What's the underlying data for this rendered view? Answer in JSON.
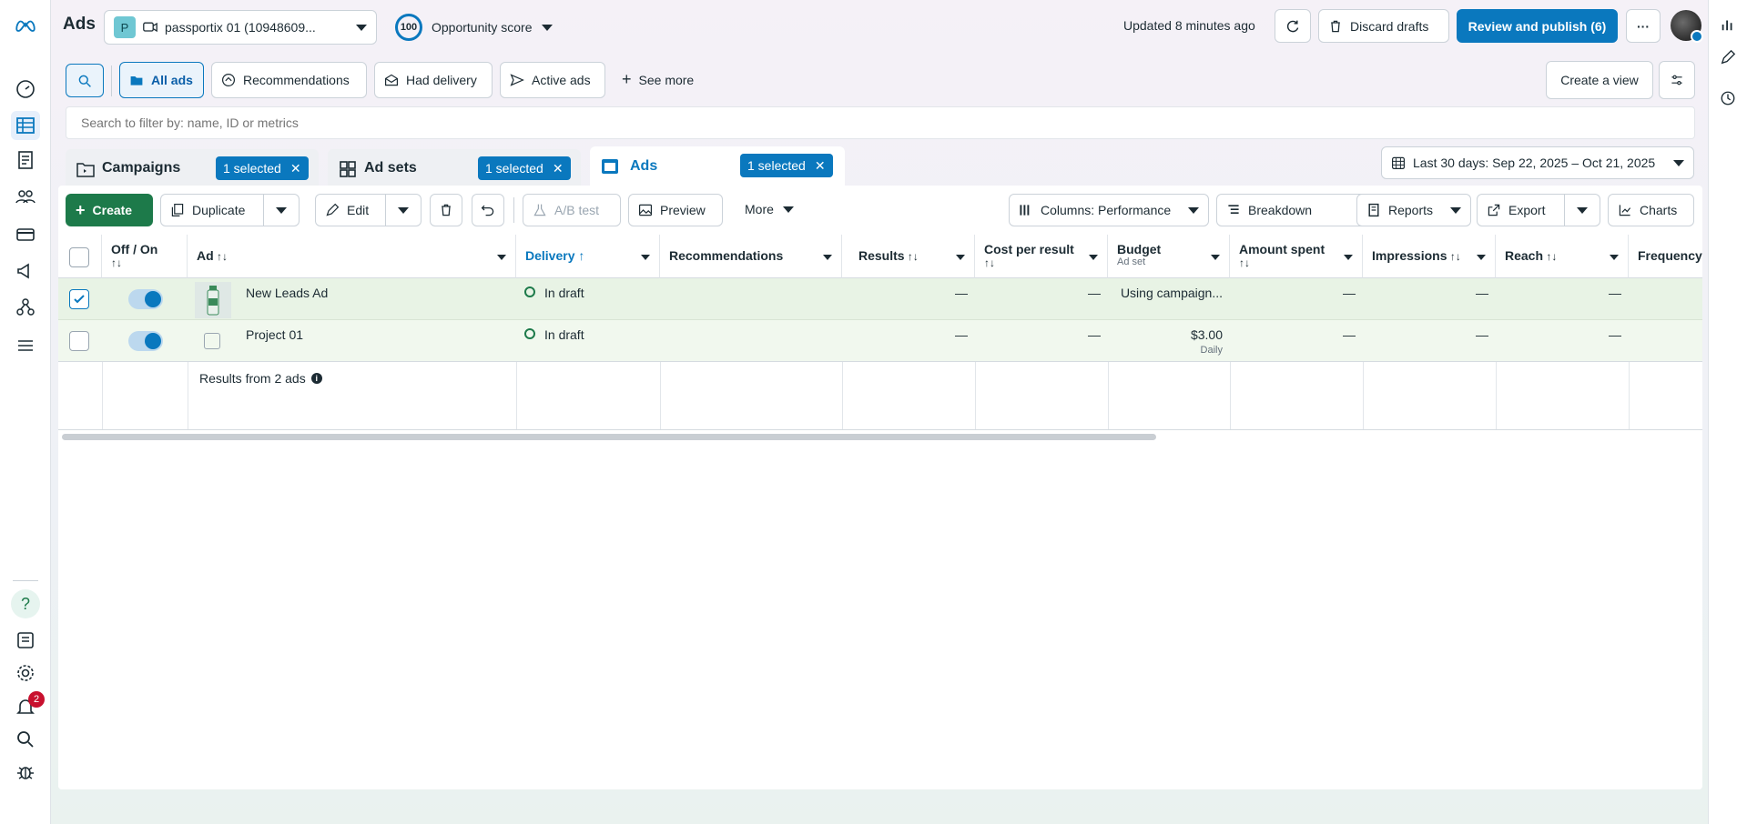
{
  "app": {
    "title": "Ads"
  },
  "account": {
    "avatar_letter": "P",
    "name": "passportix 01 (10948609..."
  },
  "opportunity": {
    "score": "100",
    "label": "Opportunity score"
  },
  "status": {
    "updated": "Updated 8 minutes ago"
  },
  "actions": {
    "discard": "Discard drafts",
    "review_publish": "Review and publish (6)"
  },
  "filters": {
    "all_ads": "All ads",
    "recommendations": "Recommendations",
    "had_delivery": "Had delivery",
    "active_ads": "Active ads",
    "see_more": "See more",
    "create_view": "Create a view"
  },
  "search": {
    "placeholder": "Search to filter by: name, ID or metrics"
  },
  "tabs": {
    "campaigns": {
      "label": "Campaigns",
      "selected": "1 selected"
    },
    "adsets": {
      "label": "Ad sets",
      "selected": "1 selected"
    },
    "ads": {
      "label": "Ads",
      "selected": "1 selected"
    }
  },
  "date_range": "Last 30 days: Sep 22, 2025 – Oct 21, 2025",
  "toolbar": {
    "create": "Create",
    "duplicate": "Duplicate",
    "edit": "Edit",
    "ab_test": "A/B test",
    "preview": "Preview",
    "more": "More",
    "columns": "Columns: Performance",
    "breakdown": "Breakdown",
    "reports": "Reports",
    "export": "Export",
    "charts": "Charts"
  },
  "table": {
    "headers": {
      "off_on": "Off / On",
      "ad": "Ad",
      "delivery": "Delivery",
      "recommendations": "Recommendations",
      "results": "Results",
      "cost_per_result": "Cost per result",
      "budget": "Budget",
      "budget_sub": "Ad set",
      "amount_spent": "Amount spent",
      "impressions": "Impressions",
      "reach": "Reach",
      "frequency": "Frequency"
    },
    "rows": [
      {
        "name": "New Leads Ad",
        "delivery": "In draft",
        "results": "—",
        "cost": "—",
        "budget": "Using campaign...",
        "budget_sub": "",
        "amount": "—",
        "impressions": "—",
        "reach": "—"
      },
      {
        "name": "Project 01",
        "delivery": "In draft",
        "results": "—",
        "cost": "—",
        "budget": "$3.00",
        "budget_sub": "Daily",
        "amount": "—",
        "impressions": "—",
        "reach": "—"
      }
    ],
    "footer": "Results from 2 ads"
  },
  "notifications": {
    "count": "2"
  },
  "colors": {
    "accent": "#0a78be",
    "create": "#1d7a4a",
    "selected_row": "#e8f3e5",
    "draft_dot": "#1d7a4a"
  }
}
